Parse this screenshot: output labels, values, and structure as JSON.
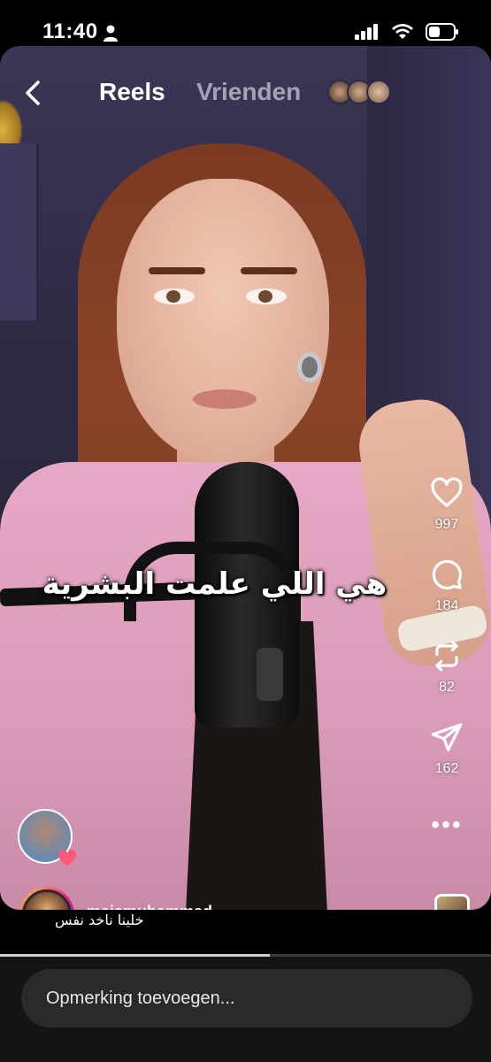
{
  "status_bar": {
    "time": "11:40",
    "icons": [
      "person-icon",
      "signal-icon",
      "wifi-icon",
      "battery-icon"
    ]
  },
  "nav": {
    "tab_reels": "Reels",
    "tab_friends": "Vrienden",
    "icons": [
      "back-icon"
    ]
  },
  "video": {
    "caption": "هي اللي علمت البشرية",
    "progress": 0.55
  },
  "actions": {
    "likes": "997",
    "comments": "184",
    "reposts": "82",
    "shares": "162",
    "icons": [
      "heart-icon",
      "comment-icon",
      "repost-icon",
      "send-icon",
      "more-icon"
    ]
  },
  "author": {
    "username": "maismuhammad",
    "description": "خلينا ناخد نفس"
  },
  "comment": {
    "placeholder": "Opmerking toevoegen..."
  },
  "colors": {
    "accent_gradient": [
      "#f9ce34",
      "#ee2a7b",
      "#6228d7"
    ],
    "background": "#000000"
  }
}
